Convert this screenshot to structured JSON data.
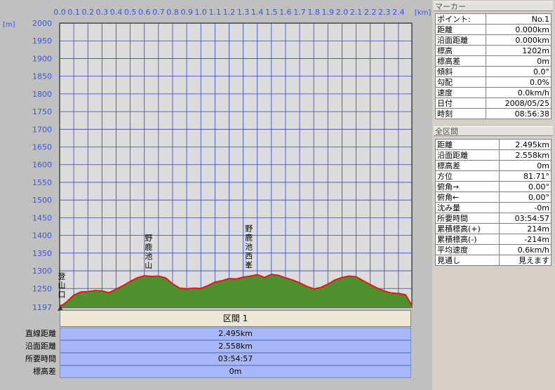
{
  "chart_data": {
    "type": "area",
    "xunit": "[km]",
    "yunit": "[m]",
    "xlim": [
      0,
      2.495
    ],
    "ylim": [
      1197,
      2000
    ],
    "x_ticks": [
      "0.0",
      "0.1",
      "0.2",
      "0.3",
      "0.4",
      "0.5",
      "0.6",
      "0.7",
      "0.8",
      "0.9",
      "1.0",
      "1.1",
      "1.2",
      "1.3",
      "1.4",
      "1.5",
      "1.6",
      "1.7",
      "1.8",
      "1.9",
      "2.0",
      "2.1",
      "2.2",
      "2.3",
      "2.4"
    ],
    "y_ticks": [
      "2000",
      "1950",
      "1900",
      "1850",
      "1800",
      "1750",
      "1700",
      "1650",
      "1600",
      "1550",
      "1500",
      "1450",
      "1400",
      "1350",
      "1300",
      "1250",
      "1197"
    ],
    "series": [
      {
        "x": [
          0,
          0.02,
          0.05,
          0.1,
          0.15,
          0.2,
          0.25,
          0.3,
          0.35,
          0.4,
          0.45,
          0.5,
          0.55,
          0.6,
          0.65,
          0.7,
          0.75,
          0.8,
          0.85,
          0.9,
          0.95,
          1.0,
          1.05,
          1.1,
          1.15,
          1.2,
          1.25,
          1.3,
          1.35,
          1.4,
          1.45,
          1.5,
          1.55,
          1.6,
          1.65,
          1.7,
          1.75,
          1.8,
          1.85,
          1.9,
          1.95,
          2.0,
          2.05,
          2.1,
          2.15,
          2.2,
          2.25,
          2.3,
          2.35,
          2.4,
          2.45,
          2.495
        ],
        "y": [
          1202,
          1203,
          1212,
          1231,
          1240,
          1241,
          1244,
          1243,
          1238,
          1248,
          1258,
          1270,
          1280,
          1286,
          1284,
          1285,
          1280,
          1263,
          1251,
          1249,
          1251,
          1250,
          1258,
          1268,
          1272,
          1278,
          1277,
          1282,
          1285,
          1289,
          1281,
          1290,
          1287,
          1280,
          1274,
          1266,
          1256,
          1249,
          1253,
          1262,
          1274,
          1281,
          1285,
          1283,
          1272,
          1261,
          1251,
          1243,
          1237,
          1236,
          1232,
          1202
        ]
      }
    ],
    "annotations": [
      {
        "x": 0.0,
        "label": "登山口"
      },
      {
        "x": 0.62,
        "label": "野鹿池山"
      },
      {
        "x": 1.33,
        "label": "野鹿池西峯"
      }
    ]
  },
  "marker": {
    "title": "マーカー",
    "rows": [
      {
        "k": "ポイント:",
        "v": "No.1"
      },
      {
        "k": "距離",
        "v": "0.000km"
      },
      {
        "k": "沿面距離",
        "v": "0.000km"
      },
      {
        "k": "標高",
        "v": "1202m"
      },
      {
        "k": "標高差",
        "v": "0m"
      },
      {
        "k": "傾斜",
        "v": "0.0°"
      },
      {
        "k": "勾配",
        "v": "0.0%"
      },
      {
        "k": "速度",
        "v": "0.0km/h"
      },
      {
        "k": "日付",
        "v": "2008/05/25"
      },
      {
        "k": "時刻",
        "v": "08:56:38"
      }
    ]
  },
  "total": {
    "title": "全区間",
    "rows": [
      {
        "k": "距離",
        "v": "2.495km"
      },
      {
        "k": "沿面距離",
        "v": "2.558km"
      },
      {
        "k": "標高差",
        "v": "0m"
      },
      {
        "k": "方位",
        "v": "81.71°"
      },
      {
        "k": "俯角→",
        "v": "0.00°"
      },
      {
        "k": "俯角←",
        "v": "0.00°"
      },
      {
        "k": "沈み量",
        "v": "-0m"
      },
      {
        "k": "所要時間",
        "v": "03:54:57"
      },
      {
        "k": "累積標高(+)",
        "v": "214m"
      },
      {
        "k": "累積標高(-)",
        "v": "-214m"
      },
      {
        "k": "平均速度",
        "v": "0.6km/h"
      },
      {
        "k": "見通し",
        "v": "見えます"
      }
    ]
  },
  "segment": {
    "header": "区間 1",
    "labels": [
      "直線距離",
      "沿面距離",
      "所要時間",
      "標高差"
    ],
    "values": [
      "2.495km",
      "2.558km",
      "03:54:57",
      "0m"
    ]
  },
  "colors": {
    "plot_bg": "#dcdcdc",
    "grid": "#3344cc",
    "fill": "#4f8f2e",
    "profile": "#e8141e",
    "axis_text": "#3b55d8",
    "row_bg": "#a6b8f8"
  }
}
